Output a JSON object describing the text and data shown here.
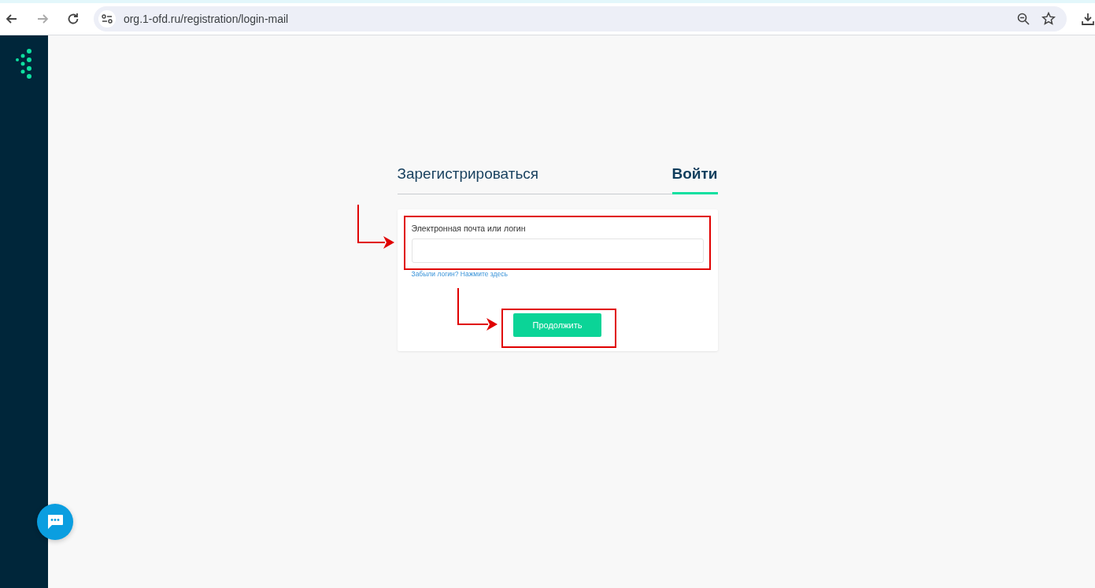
{
  "browser": {
    "url": "org.1-ofd.ru/registration/login-mail"
  },
  "tabs": [
    {
      "label": "Зарегистрироваться",
      "selected": false
    },
    {
      "label": "Войти",
      "selected": true
    }
  ],
  "form": {
    "field_label": "Электронная почта или логин",
    "forgot_link": "Забыли логин? Нажмите здесь",
    "submit_button": "Продолжить"
  }
}
